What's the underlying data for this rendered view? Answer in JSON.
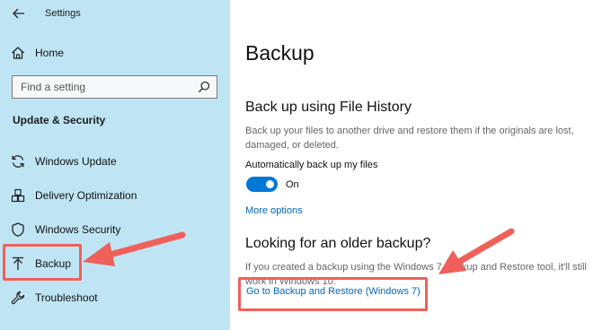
{
  "window": {
    "title": "Settings"
  },
  "sidebar": {
    "home_label": "Home",
    "search_placeholder": "Find a setting",
    "section_title": "Update & Security",
    "items": [
      {
        "label": "Windows Update",
        "icon": "refresh-icon"
      },
      {
        "label": "Delivery Optimization",
        "icon": "delivery-optimization-icon"
      },
      {
        "label": "Windows Security",
        "icon": "shield-icon"
      },
      {
        "label": "Backup",
        "icon": "upload-arrow-icon",
        "selected": true
      },
      {
        "label": "Troubleshoot",
        "icon": "wrench-icon"
      }
    ]
  },
  "main": {
    "page_title": "Backup",
    "file_history": {
      "heading": "Back up using File History",
      "description": "Back up your files to another drive and restore them if the originals are lost, damaged, or deleted.",
      "toggle_label": "Automatically back up my files",
      "toggle_state": "On",
      "toggle_on": true,
      "more_options_link": "More options"
    },
    "older_backup": {
      "heading": "Looking for an older backup?",
      "description": "If you created a backup using the Windows 7 Backup and Restore tool, it'll still work in Windows 10.",
      "link": "Go to Backup and Restore (Windows 7)"
    }
  },
  "colors": {
    "sidebar_bg": "#bfe5f5",
    "accent": "#0078d7",
    "link": "#0067b8",
    "annotation": "#f0605a"
  }
}
